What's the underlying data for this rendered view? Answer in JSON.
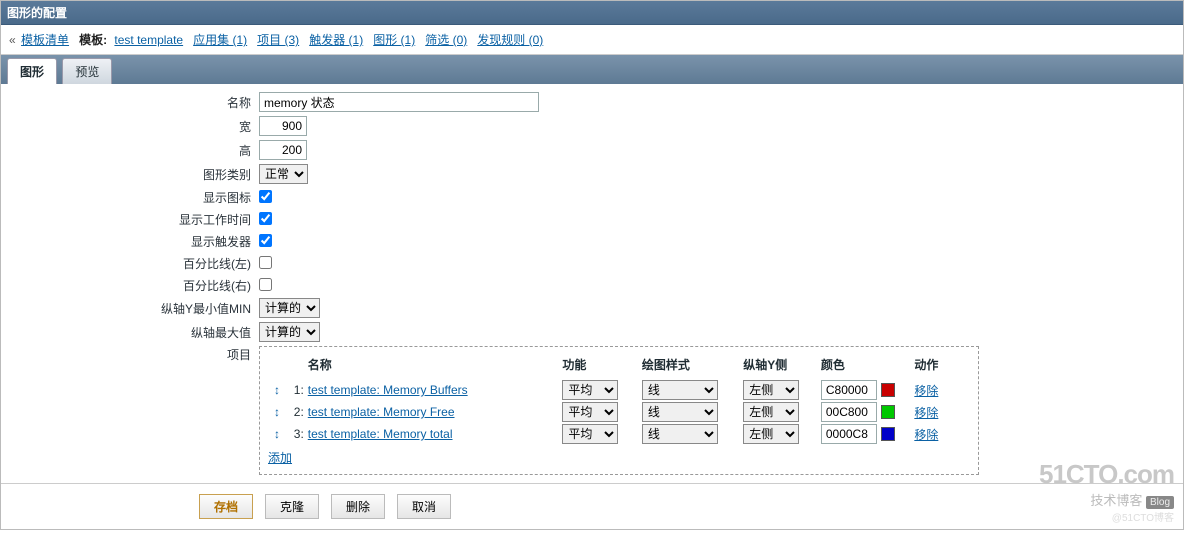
{
  "header": {
    "title": "图形的配置"
  },
  "breadcrumb": {
    "back": "模板清单",
    "template_label": "模板:",
    "template_link": "test template",
    "apps": "应用集 (1)",
    "items": "项目 (3)",
    "triggers": "触发器 (1)",
    "graphs": "图形 (1)",
    "screens": "筛选 (0)",
    "discovery": "发现规则 (0)"
  },
  "tabs": {
    "graph": "图形",
    "preview": "预览"
  },
  "form": {
    "name_label": "名称",
    "name_value": "memory 状态",
    "width_label": "宽",
    "width_value": "900",
    "height_label": "高",
    "height_value": "200",
    "type_label": "图形类别",
    "type_value": "正常",
    "show_legend_label": "显示图标",
    "show_worktime_label": "显示工作时间",
    "show_triggers_label": "显示触发器",
    "percent_left_label": "百分比线(左)",
    "percent_right_label": "百分比线(右)",
    "ymin_label": "纵轴Y最小值MIN",
    "ymin_value": "计算的",
    "ymax_label": "纵轴最大值",
    "ymax_value": "计算的",
    "items_label": "项目"
  },
  "items_table": {
    "head": {
      "name": "名称",
      "func": "功能",
      "style": "绘图样式",
      "side": "纵轴Y侧",
      "color": "颜色",
      "action": "动作"
    },
    "func_opt": "平均",
    "style_opt": "线",
    "side_opt": "左侧",
    "remove": "移除",
    "add": "添加",
    "rows": [
      {
        "idx": "1:",
        "name": "test template: Memory Buffers",
        "color": "C80000",
        "swatch": "#c80000"
      },
      {
        "idx": "2:",
        "name": "test template: Memory Free",
        "color": "00C800",
        "swatch": "#00c800"
      },
      {
        "idx": "3:",
        "name": "test template: Memory total",
        "color": "0000C8",
        "swatch": "#0000c8"
      }
    ]
  },
  "footer": {
    "save": "存档",
    "clone": "克隆",
    "delete": "删除",
    "cancel": "取消"
  },
  "watermark": {
    "big": "51CTO.com",
    "sub": "技术博客",
    "tag": "Blog",
    "faint": "@51CTO博客"
  }
}
